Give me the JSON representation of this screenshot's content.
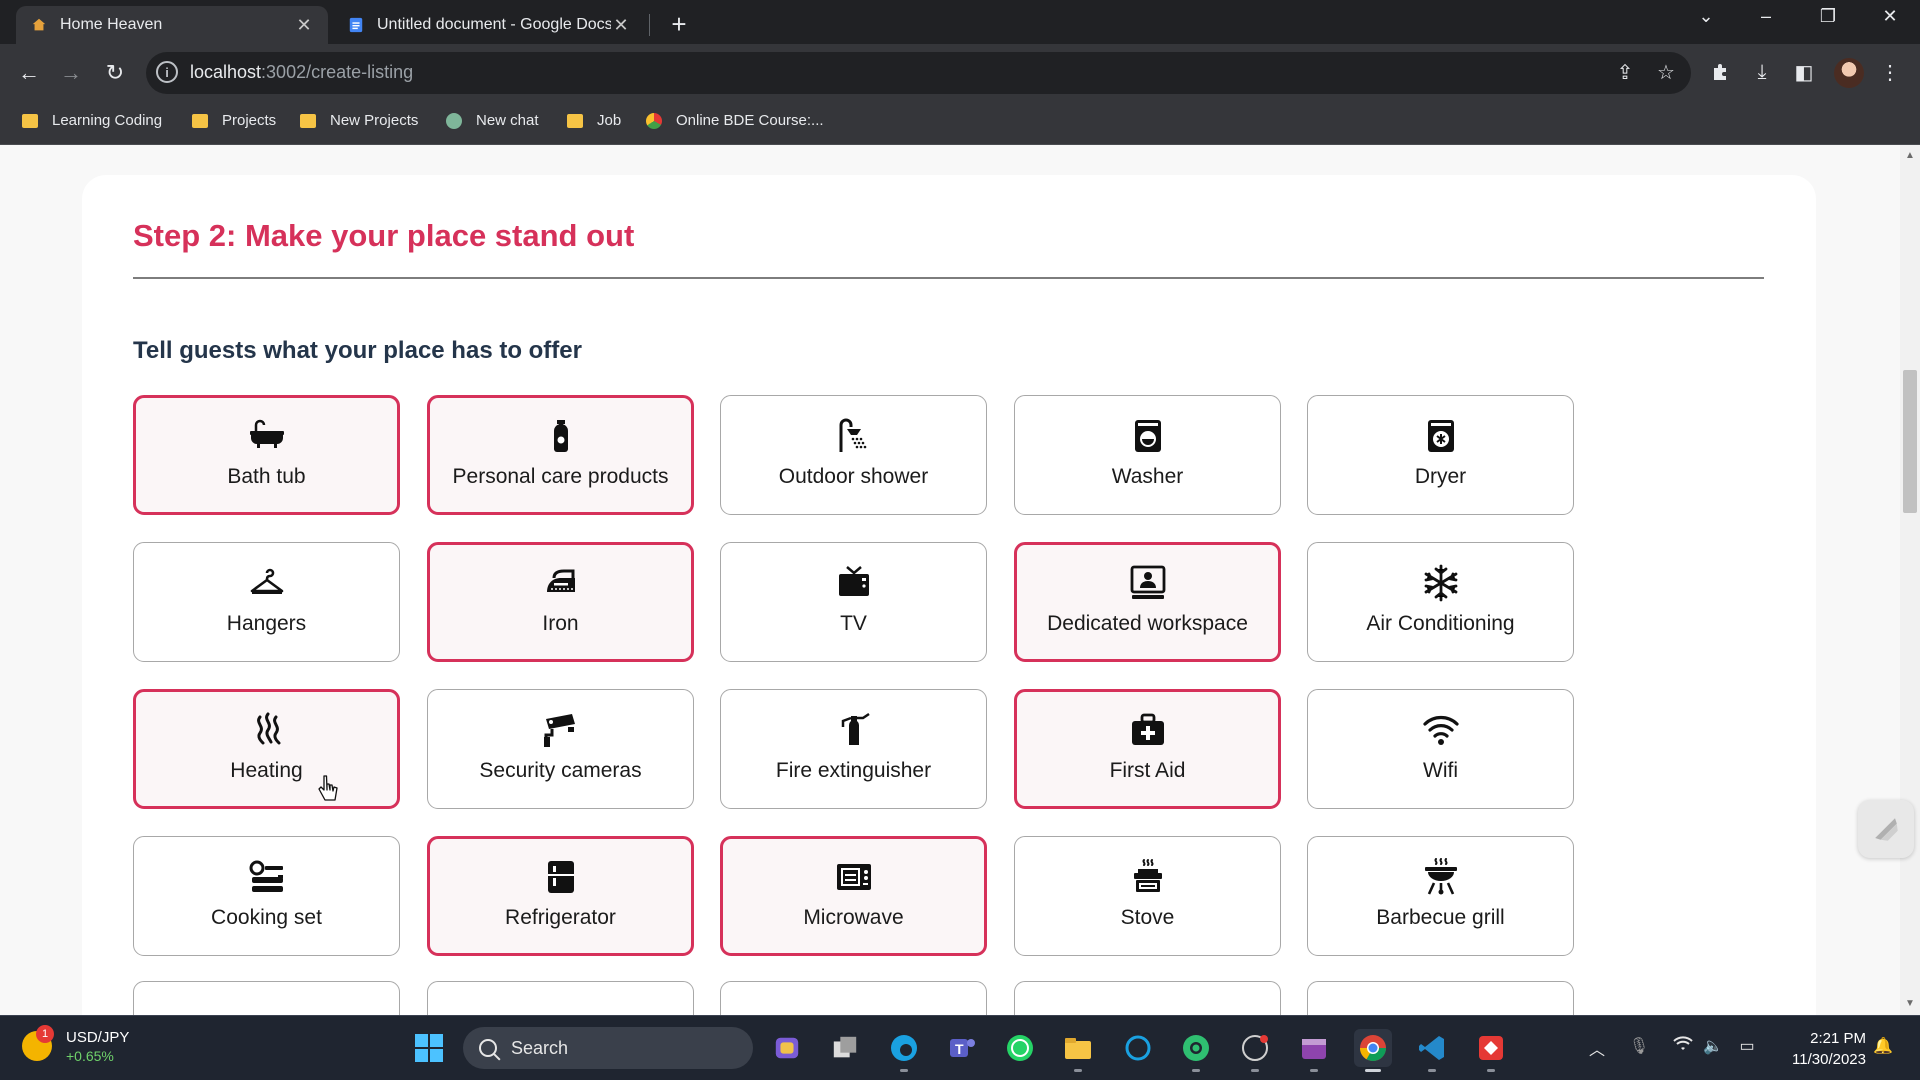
{
  "browser": {
    "tabs": [
      {
        "title": "Home Heaven",
        "active": true
      },
      {
        "title": "Untitled document - Google Docs",
        "active": false
      }
    ],
    "new_tab": "+",
    "url_host": "localhost",
    "url_path": ":3002/create-listing",
    "bookmarks": [
      {
        "label": "Learning Coding",
        "icon": "folder-icon"
      },
      {
        "label": "Projects",
        "icon": "folder-icon"
      },
      {
        "label": "New Projects",
        "icon": "folder-icon"
      },
      {
        "label": "New chat",
        "icon": "chatgpt-icon"
      },
      {
        "label": "Job",
        "icon": "folder-icon"
      },
      {
        "label": "Online BDE Course:...",
        "icon": "site-icon"
      }
    ]
  },
  "page": {
    "step_title": "Step 2: Make your place stand out",
    "subtitle": "Tell guests what your place has to offer",
    "accent_color": "#d6315a",
    "amenities": [
      {
        "label": "Bath tub",
        "icon": "bathtub-icon",
        "selected": true
      },
      {
        "label": "Personal care products",
        "icon": "care-products-icon",
        "selected": true
      },
      {
        "label": "Outdoor shower",
        "icon": "shower-icon",
        "selected": false
      },
      {
        "label": "Washer",
        "icon": "washer-icon",
        "selected": false
      },
      {
        "label": "Dryer",
        "icon": "dryer-icon",
        "selected": false
      },
      {
        "label": "Hangers",
        "icon": "hanger-icon",
        "selected": false
      },
      {
        "label": "Iron",
        "icon": "iron-icon",
        "selected": true
      },
      {
        "label": "TV",
        "icon": "tv-icon",
        "selected": false
      },
      {
        "label": "Dedicated workspace",
        "icon": "workspace-icon",
        "selected": true
      },
      {
        "label": "Air Conditioning",
        "icon": "snowflake-icon",
        "selected": false
      },
      {
        "label": "Heating",
        "icon": "heating-icon",
        "selected": true
      },
      {
        "label": "Security cameras",
        "icon": "camera-icon",
        "selected": false
      },
      {
        "label": "Fire extinguisher",
        "icon": "extinguisher-icon",
        "selected": false
      },
      {
        "label": "First Aid",
        "icon": "first-aid-icon",
        "selected": true
      },
      {
        "label": "Wifi",
        "icon": "wifi-icon",
        "selected": false
      },
      {
        "label": "Cooking set",
        "icon": "cooking-set-icon",
        "selected": false
      },
      {
        "label": "Refrigerator",
        "icon": "fridge-icon",
        "selected": true
      },
      {
        "label": "Microwave",
        "icon": "microwave-icon",
        "selected": true
      },
      {
        "label": "Stove",
        "icon": "stove-icon",
        "selected": false
      },
      {
        "label": "Barbecue grill",
        "icon": "grill-icon",
        "selected": false
      }
    ]
  },
  "taskbar": {
    "ticker_pair": "USD/JPY",
    "ticker_change": "+0.65%",
    "ticker_badge": "1",
    "search_placeholder": "Search",
    "time": "2:21 PM",
    "date": "11/30/2023"
  }
}
